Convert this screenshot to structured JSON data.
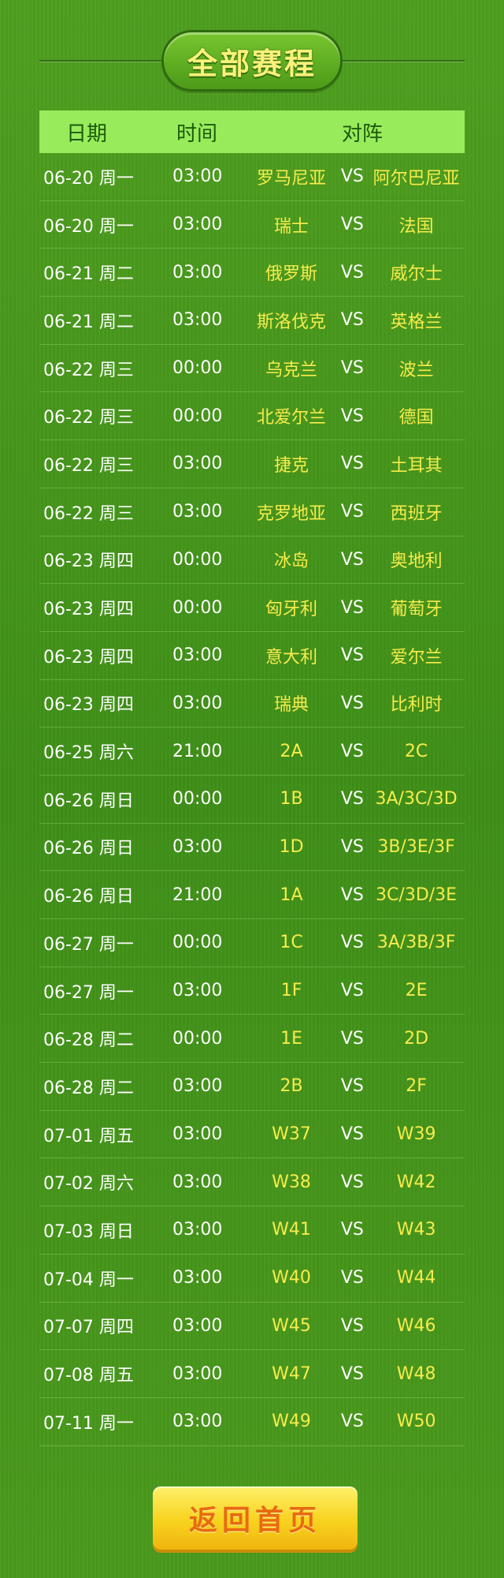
{
  "title": "全部赛程",
  "header": {
    "date": "日期",
    "time": "时间",
    "match": "对阵"
  },
  "vs_label": "VS",
  "matches": [
    {
      "date": "06-20 周一",
      "time": "03:00",
      "team_a": "罗马尼亚",
      "team_b": "阿尔巴尼亚"
    },
    {
      "date": "06-20 周一",
      "time": "03:00",
      "team_a": "瑞士",
      "team_b": "法国"
    },
    {
      "date": "06-21 周二",
      "time": "03:00",
      "team_a": "俄罗斯",
      "team_b": "威尔士"
    },
    {
      "date": "06-21 周二",
      "time": "03:00",
      "team_a": "斯洛伐克",
      "team_b": "英格兰"
    },
    {
      "date": "06-22 周三",
      "time": "00:00",
      "team_a": "乌克兰",
      "team_b": "波兰"
    },
    {
      "date": "06-22 周三",
      "time": "00:00",
      "team_a": "北爱尔兰",
      "team_b": "德国"
    },
    {
      "date": "06-22 周三",
      "time": "03:00",
      "team_a": "捷克",
      "team_b": "土耳其"
    },
    {
      "date": "06-22 周三",
      "time": "03:00",
      "team_a": "克罗地亚",
      "team_b": "西班牙"
    },
    {
      "date": "06-23 周四",
      "time": "00:00",
      "team_a": "冰岛",
      "team_b": "奥地利"
    },
    {
      "date": "06-23 周四",
      "time": "00:00",
      "team_a": "匈牙利",
      "team_b": "葡萄牙"
    },
    {
      "date": "06-23 周四",
      "time": "03:00",
      "team_a": "意大利",
      "team_b": "爱尔兰"
    },
    {
      "date": "06-23 周四",
      "time": "03:00",
      "team_a": "瑞典",
      "team_b": "比利时"
    },
    {
      "date": "06-25 周六",
      "time": "21:00",
      "team_a": "2A",
      "team_b": "2C"
    },
    {
      "date": "06-26 周日",
      "time": "00:00",
      "team_a": "1B",
      "team_b": "3A/3C/3D"
    },
    {
      "date": "06-26 周日",
      "time": "03:00",
      "team_a": "1D",
      "team_b": "3B/3E/3F"
    },
    {
      "date": "06-26 周日",
      "time": "21:00",
      "team_a": "1A",
      "team_b": "3C/3D/3E"
    },
    {
      "date": "06-27 周一",
      "time": "00:00",
      "team_a": "1C",
      "team_b": "3A/3B/3F"
    },
    {
      "date": "06-27 周一",
      "time": "03:00",
      "team_a": "1F",
      "team_b": "2E"
    },
    {
      "date": "06-28 周二",
      "time": "00:00",
      "team_a": "1E",
      "team_b": "2D"
    },
    {
      "date": "06-28 周二",
      "time": "03:00",
      "team_a": "2B",
      "team_b": "2F"
    },
    {
      "date": "07-01 周五",
      "time": "03:00",
      "team_a": "W37",
      "team_b": "W39"
    },
    {
      "date": "07-02 周六",
      "time": "03:00",
      "team_a": "W38",
      "team_b": "W42"
    },
    {
      "date": "07-03 周日",
      "time": "03:00",
      "team_a": "W41",
      "team_b": "W43"
    },
    {
      "date": "07-04 周一",
      "time": "03:00",
      "team_a": "W40",
      "team_b": "W44"
    },
    {
      "date": "07-07 周四",
      "time": "03:00",
      "team_a": "W45",
      "team_b": "W46"
    },
    {
      "date": "07-08 周五",
      "time": "03:00",
      "team_a": "W47",
      "team_b": "W48"
    },
    {
      "date": "07-11 周一",
      "time": "03:00",
      "team_a": "W49",
      "team_b": "W50"
    }
  ],
  "back_button": "返回首页",
  "colors": {
    "background": "#4a9a1e",
    "header_bar": "#98ec5c",
    "team_text": "#f7ec4c",
    "button": "#f7d21e",
    "button_text": "#e86a10"
  }
}
